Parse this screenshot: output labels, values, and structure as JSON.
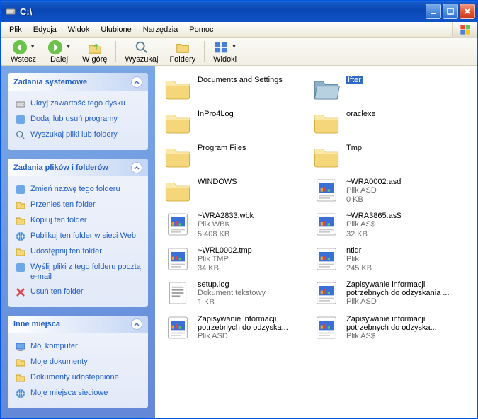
{
  "title": "C:\\",
  "menu": [
    "Plik",
    "Edycja",
    "Widok",
    "Ulubione",
    "Narzędzia",
    "Pomoc"
  ],
  "toolbar": {
    "back": "Wstecz",
    "forward": "Dalej",
    "up": "W górę",
    "search": "Wyszukaj",
    "folders": "Foldery",
    "views": "Widoki"
  },
  "panels": [
    {
      "title": "Zadania systemowe",
      "links": [
        {
          "icon": "hide",
          "text": "Ukryj zawartość tego dysku"
        },
        {
          "icon": "addremove",
          "text": "Dodaj lub usuń programy"
        },
        {
          "icon": "search",
          "text": "Wyszukaj pliki lub foldery"
        }
      ]
    },
    {
      "title": "Zadania plików i folderów",
      "links": [
        {
          "icon": "rename",
          "text": "Zmień nazwę tego folderu"
        },
        {
          "icon": "move",
          "text": "Przenieś ten folder"
        },
        {
          "icon": "copy",
          "text": "Kopiuj ten folder"
        },
        {
          "icon": "publish",
          "text": "Publikuj ten folder w sieci Web"
        },
        {
          "icon": "share",
          "text": "Udostępnij ten folder"
        },
        {
          "icon": "email",
          "text": "Wyślij pliki z tego folderu pocztą e-mail"
        },
        {
          "icon": "delete",
          "text": "Usuń ten folder"
        }
      ]
    },
    {
      "title": "Inne miejsca",
      "links": [
        {
          "icon": "mycomputer",
          "text": "Mój komputer"
        },
        {
          "icon": "mydocs",
          "text": "Moje dokumenty"
        },
        {
          "icon": "shared",
          "text": "Dokumenty udostępnione"
        },
        {
          "icon": "network",
          "text": "Moje miejsca sieciowe"
        }
      ]
    }
  ],
  "items": [
    {
      "icon": "folder",
      "name": "Documents and Settings"
    },
    {
      "icon": "folder-open",
      "name": "Ifter",
      "selected": true
    },
    {
      "icon": "folder",
      "name": "InPro4Log"
    },
    {
      "icon": "folder",
      "name": "oraclexe"
    },
    {
      "icon": "folder",
      "name": "Program Files"
    },
    {
      "icon": "folder",
      "name": "Tmp"
    },
    {
      "icon": "folder",
      "name": "WINDOWS"
    },
    {
      "icon": "file-app",
      "name": "~WRA0002.asd",
      "sub1": "Plik ASD",
      "sub2": "0 KB"
    },
    {
      "icon": "file-app",
      "name": "~WRA2833.wbk",
      "sub1": "Plik WBK",
      "sub2": "5 408 KB"
    },
    {
      "icon": "file-app",
      "name": "~WRA3865.as$",
      "sub1": "Plik AS$",
      "sub2": "32 KB"
    },
    {
      "icon": "file-app",
      "name": "~WRL0002.tmp",
      "sub1": "Plik TMP",
      "sub2": "34 KB"
    },
    {
      "icon": "file-app",
      "name": "ntldr",
      "sub1": "Plik",
      "sub2": "245 KB"
    },
    {
      "icon": "file-txt",
      "name": "setup.log",
      "sub1": "Dokument tekstowy",
      "sub2": "1 KB"
    },
    {
      "icon": "file-app",
      "name": "Zapisywanie informacji potrzebnych do odzyskania ...",
      "sub1": "Plik ASD",
      "multiline": true
    },
    {
      "icon": "file-app",
      "name": "Zapisywanie informacji potrzebnych do odzyska...",
      "sub1": "Plik ASD",
      "multiline": true
    },
    {
      "icon": "file-app",
      "name": "Zapisywanie informacji potrzebnych do odzyska...",
      "sub1": "Plik AS$",
      "multiline": true
    }
  ]
}
